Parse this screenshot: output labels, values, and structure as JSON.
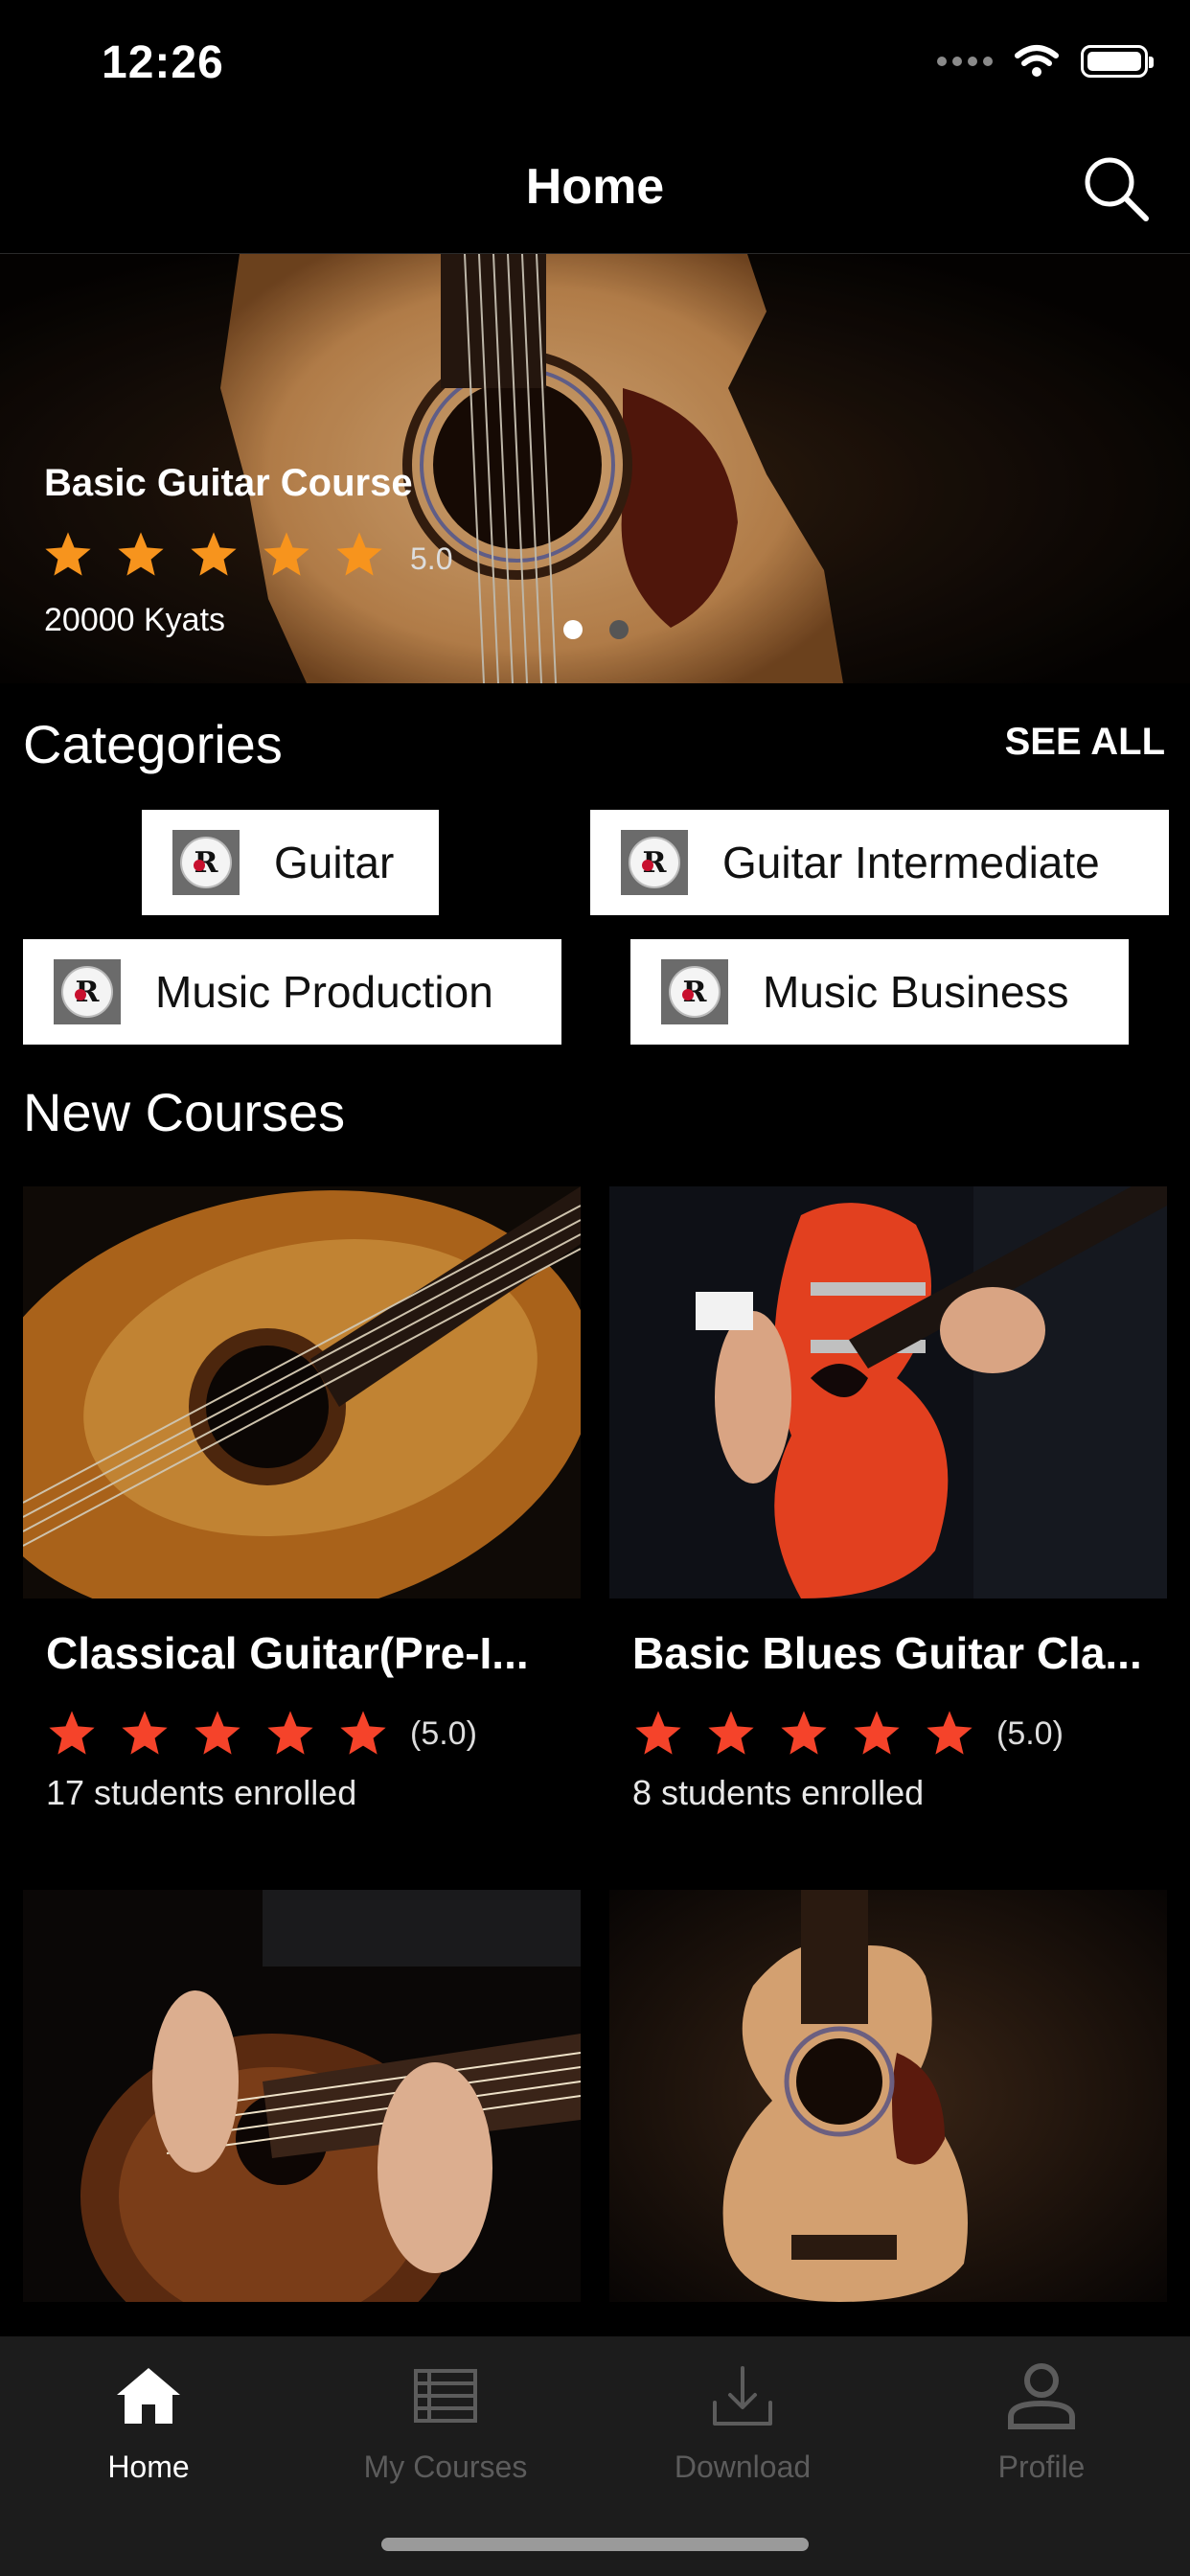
{
  "status_bar": {
    "time": "12:26"
  },
  "header": {
    "title": "Home"
  },
  "icons": {
    "search": "search-icon",
    "home": "home-icon",
    "courses": "list-icon",
    "download": "download-icon",
    "profile": "person-icon",
    "star": "star-icon"
  },
  "banner": {
    "title": "Basic Guitar Course",
    "rating_value": "5.0",
    "star_count": 5,
    "price": "20000 Kyats",
    "pages": 2,
    "active_page": 1
  },
  "categories": {
    "title": "Categories",
    "see_all": "SEE ALL",
    "items": [
      {
        "label": "Guitar"
      },
      {
        "label": "Guitar Intermediate"
      },
      {
        "label": "Music Production"
      },
      {
        "label": "Music Business"
      }
    ]
  },
  "new_courses": {
    "title": "New Courses",
    "items": [
      {
        "title": "Classical Guitar(Pre-I...",
        "rating": "(5.0)",
        "enrolled": "17 students enrolled"
      },
      {
        "title": "Basic Blues Guitar Cla...",
        "rating": "(5.0)",
        "enrolled": "8 students enrolled"
      }
    ]
  },
  "tabbar": {
    "items": [
      {
        "label": "Home",
        "active": true
      },
      {
        "label": "My Courses",
        "active": false
      },
      {
        "label": "Download",
        "active": false
      },
      {
        "label": "Profile",
        "active": false
      }
    ]
  },
  "colors": {
    "star_banner": "#f7941d",
    "star_card": "#f5432a",
    "active_tab": "#ffffff",
    "inactive_tab": "#5c5c5c",
    "tabbar_bg": "#1c1c1c"
  }
}
